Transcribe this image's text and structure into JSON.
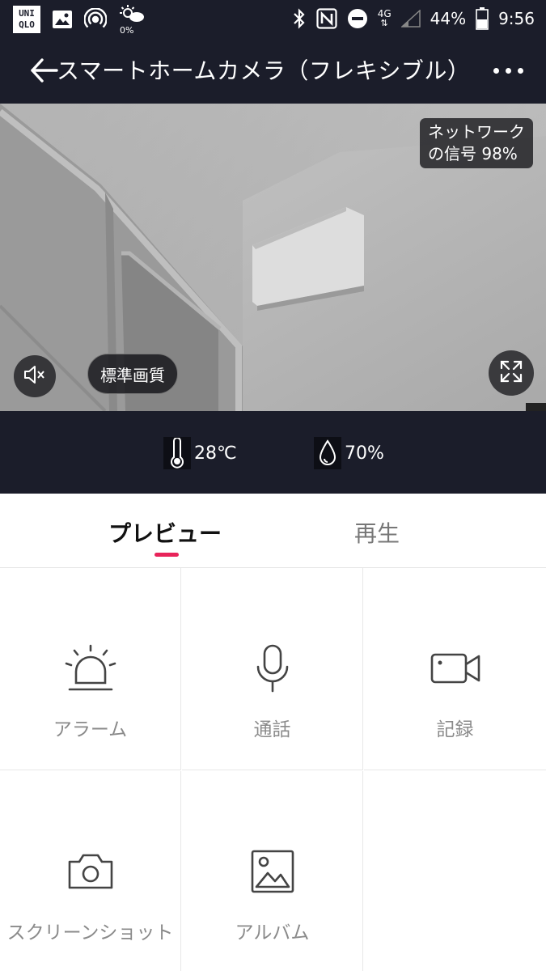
{
  "status_bar": {
    "app_badge": "UNI\nQLO",
    "weather_percent": "0%",
    "network_type": "4G",
    "battery": "44%",
    "time": "9:56"
  },
  "header": {
    "title": "スマートホームカメラ（フレキシブル）"
  },
  "video": {
    "signal_label_line1": "ネットワーク",
    "signal_label_line2": "の信号 98%",
    "quality_label": "標準画質"
  },
  "sensors": {
    "temperature": "28℃",
    "humidity": "70%"
  },
  "tabs": [
    {
      "label": "プレビュー",
      "active": true
    },
    {
      "label": "再生",
      "active": false
    }
  ],
  "controls": [
    {
      "label": "アラーム",
      "icon": "alarm-light-icon"
    },
    {
      "label": "通話",
      "icon": "microphone-icon"
    },
    {
      "label": "記録",
      "icon": "video-camera-icon"
    },
    {
      "label": "スクリーンショット",
      "icon": "camera-icon"
    },
    {
      "label": "アルバム",
      "icon": "image-icon"
    }
  ],
  "colors": {
    "header_bg": "#1b1d2a",
    "accent": "#e8245a",
    "label_gray": "#8a8a8a"
  }
}
